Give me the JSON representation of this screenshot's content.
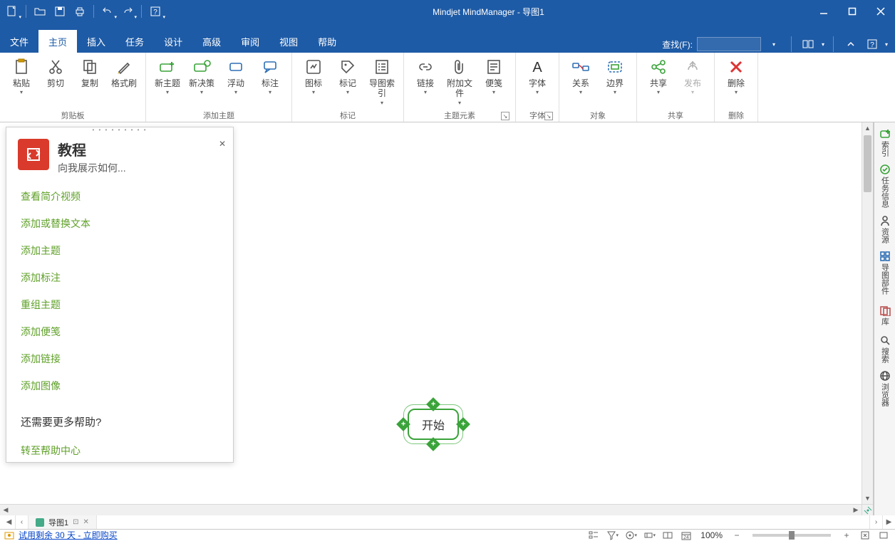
{
  "title": "Mindjet MindManager - 导图1",
  "quickAccess": {
    "new": "新建",
    "open": "打开",
    "save": "保存",
    "print": "打印",
    "undo": "撤消",
    "redo": "重做",
    "help": "帮助"
  },
  "winControls": {
    "min": "最小化",
    "max": "最大化",
    "close": "关闭"
  },
  "menubar": {
    "tabs": [
      "文件",
      "主页",
      "插入",
      "任务",
      "设计",
      "高级",
      "审阅",
      "视图",
      "帮助"
    ],
    "activeIndex": 1,
    "findLabel": "查找(F):"
  },
  "menubarRight": {
    "collapse": "折叠功能区",
    "window": "窗口",
    "helpDD": "帮助"
  },
  "ribbon": {
    "groups": [
      {
        "label": "剪贴板",
        "launcher": false,
        "items": [
          {
            "key": "paste",
            "label": "粘贴",
            "dd": true,
            "type": "paste"
          },
          {
            "key": "cut",
            "label": "剪切",
            "dd": false,
            "type": "cut"
          },
          {
            "key": "copy",
            "label": "复制",
            "dd": false,
            "type": "copy"
          },
          {
            "key": "formatPainter",
            "label": "格式刷",
            "dd": false,
            "type": "brush"
          }
        ]
      },
      {
        "label": "添加主题",
        "launcher": false,
        "items": [
          {
            "key": "newTopic",
            "label": "新主题",
            "dd": true,
            "type": "topicNew"
          },
          {
            "key": "newDecision",
            "label": "新决策",
            "dd": true,
            "type": "topicDec"
          },
          {
            "key": "floating",
            "label": "浮动",
            "dd": true,
            "type": "floating"
          },
          {
            "key": "callout",
            "label": "标注",
            "dd": true,
            "type": "callout"
          }
        ]
      },
      {
        "label": "标记",
        "launcher": false,
        "items": [
          {
            "key": "icons",
            "label": "图标",
            "dd": true,
            "type": "icon"
          },
          {
            "key": "tags",
            "label": "标记",
            "dd": true,
            "type": "tag"
          },
          {
            "key": "index",
            "label": "导图索引",
            "dd": true,
            "type": "index"
          }
        ]
      },
      {
        "label": "主题元素",
        "launcher": true,
        "items": [
          {
            "key": "link",
            "label": "链接",
            "dd": true,
            "type": "link"
          },
          {
            "key": "attach",
            "label": "附加文件",
            "dd": true,
            "type": "attach"
          },
          {
            "key": "notes",
            "label": "便笺",
            "dd": true,
            "type": "notes"
          }
        ]
      },
      {
        "label": "字体",
        "launcher": true,
        "items": [
          {
            "key": "font",
            "label": "字体",
            "dd": true,
            "type": "font"
          }
        ]
      },
      {
        "label": "对象",
        "launcher": false,
        "items": [
          {
            "key": "relationship",
            "label": "关系",
            "dd": true,
            "type": "relation"
          },
          {
            "key": "boundary",
            "label": "边界",
            "dd": true,
            "type": "boundary"
          }
        ]
      },
      {
        "label": "共享",
        "launcher": false,
        "items": [
          {
            "key": "share",
            "label": "共享",
            "dd": true,
            "type": "share"
          },
          {
            "key": "publish",
            "label": "发布",
            "dd": true,
            "type": "publish",
            "disabled": true
          }
        ]
      },
      {
        "label": "删除",
        "launcher": false,
        "items": [
          {
            "key": "delete",
            "label": "删除",
            "dd": true,
            "type": "delete"
          }
        ]
      }
    ]
  },
  "sidepanel": {
    "items": [
      {
        "key": "index",
        "label": "索引",
        "color": "#3aa33a",
        "icon": "plus"
      },
      {
        "key": "taskinfo",
        "label": "任务信息",
        "color": "#3aa33a",
        "icon": "check"
      },
      {
        "key": "resources",
        "label": "资源",
        "color": "#555",
        "icon": "person"
      },
      {
        "key": "mapparts",
        "label": "导图部件",
        "color": "#2e6fb5",
        "icon": "parts"
      },
      {
        "key": "library",
        "label": "库",
        "color": "#b55",
        "icon": "lib"
      },
      {
        "key": "search",
        "label": "搜索",
        "color": "#555",
        "icon": "search"
      },
      {
        "key": "browser",
        "label": "浏览器",
        "color": "#555",
        "icon": "browser"
      }
    ]
  },
  "tutorial": {
    "title": "教程",
    "subtitle": "向我展示如何...",
    "links": [
      "查看简介视频",
      "添加或替换文本",
      "添加主题",
      "添加标注",
      "重组主题",
      "添加便笺",
      "添加链接",
      "添加图像"
    ],
    "moreHelp": "还需要更多帮助?",
    "helpCenter": "转至帮助中心"
  },
  "canvas": {
    "centralTopic": "开始"
  },
  "tabbar": {
    "docName": "导图1"
  },
  "statusbar": {
    "trialText": "试用剩余 30 天 - 立即购买",
    "zoomValue": "100%",
    "icons": {
      "outline": "大纲",
      "filter": "筛选",
      "target": "焦点",
      "collapse": "折叠",
      "linked": "链接",
      "calendar": "日历",
      "zoomOut": "-",
      "zoomIn": "+",
      "fit": "适应",
      "full": "全屏"
    }
  }
}
